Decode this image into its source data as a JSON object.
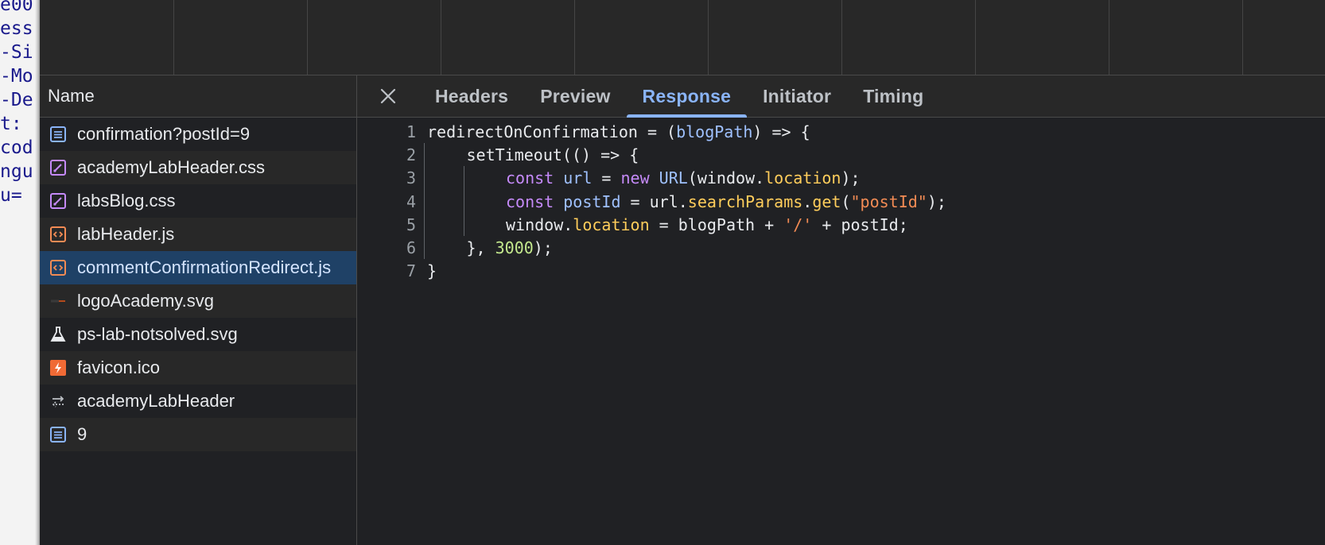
{
  "background_page": {
    "lines": [
      "e00",
      "ess",
      "-Si",
      "-Mo",
      "-De",
      "t: ",
      "cod",
      "ngu",
      " u="
    ]
  },
  "name_panel": {
    "header": "Name",
    "requests": [
      {
        "name": "confirmation?postId=9",
        "icon": "document-icon",
        "selected": false
      },
      {
        "name": "academyLabHeader.css",
        "icon": "stylesheet-icon",
        "selected": false
      },
      {
        "name": "labsBlog.css",
        "icon": "stylesheet-icon",
        "selected": false
      },
      {
        "name": "labHeader.js",
        "icon": "script-icon",
        "selected": false
      },
      {
        "name": "commentConfirmationRedirect.js",
        "icon": "script-icon",
        "selected": true
      },
      {
        "name": "logoAcademy.svg",
        "icon": "image-icon",
        "selected": false
      },
      {
        "name": "ps-lab-notsolved.svg",
        "icon": "flask-icon",
        "selected": false
      },
      {
        "name": "favicon.ico",
        "icon": "favicon-icon",
        "selected": false
      },
      {
        "name": "academyLabHeader",
        "icon": "websocket-icon",
        "selected": false
      },
      {
        "name": "9",
        "icon": "document-icon",
        "selected": false
      }
    ]
  },
  "detail": {
    "tabs": [
      {
        "label": "Headers",
        "active": false
      },
      {
        "label": "Preview",
        "active": false
      },
      {
        "label": "Response",
        "active": true
      },
      {
        "label": "Initiator",
        "active": false
      },
      {
        "label": "Timing",
        "active": false
      }
    ],
    "code_lines": [
      {
        "num": "1",
        "indent": 0,
        "tokens": [
          [
            "plain",
            "redirectOnConfirmation = ("
          ],
          [
            "def",
            "blogPath"
          ],
          [
            "plain",
            ") => {"
          ]
        ]
      },
      {
        "num": "2",
        "indent": 1,
        "tokens": [
          [
            "plain",
            "setTimeout(() => {"
          ]
        ]
      },
      {
        "num": "3",
        "indent": 2,
        "tokens": [
          [
            "kw",
            "const "
          ],
          [
            "def",
            "url"
          ],
          [
            "plain",
            " = "
          ],
          [
            "kw",
            "new "
          ],
          [
            "def",
            "URL"
          ],
          [
            "plain",
            "(window."
          ],
          [
            "prop",
            "location"
          ],
          [
            "plain",
            ");"
          ]
        ]
      },
      {
        "num": "4",
        "indent": 2,
        "tokens": [
          [
            "kw",
            "const "
          ],
          [
            "def",
            "postId"
          ],
          [
            "plain",
            " = url."
          ],
          [
            "prop",
            "searchParams"
          ],
          [
            "plain",
            "."
          ],
          [
            "prop",
            "get"
          ],
          [
            "plain",
            "("
          ],
          [
            "str",
            "\"postId\""
          ],
          [
            "plain",
            ");"
          ]
        ]
      },
      {
        "num": "5",
        "indent": 2,
        "tokens": [
          [
            "plain",
            "window."
          ],
          [
            "prop",
            "location"
          ],
          [
            "plain",
            " = blogPath + "
          ],
          [
            "str",
            "'/'"
          ],
          [
            "plain",
            " + postId;"
          ]
        ]
      },
      {
        "num": "6",
        "indent": 1,
        "tokens": [
          [
            "plain",
            "}, "
          ],
          [
            "num",
            "3000"
          ],
          [
            "plain",
            ");"
          ]
        ]
      },
      {
        "num": "7",
        "indent": 0,
        "tokens": [
          [
            "plain",
            "}"
          ]
        ]
      }
    ]
  },
  "colors": {
    "accent": "#8ab4f8",
    "selected_row": "#1f4166",
    "keyword": "#c58af9",
    "definition": "#9fc1ff",
    "property": "#ffcd5b",
    "string": "#f28b54",
    "number": "#c3e88d"
  }
}
